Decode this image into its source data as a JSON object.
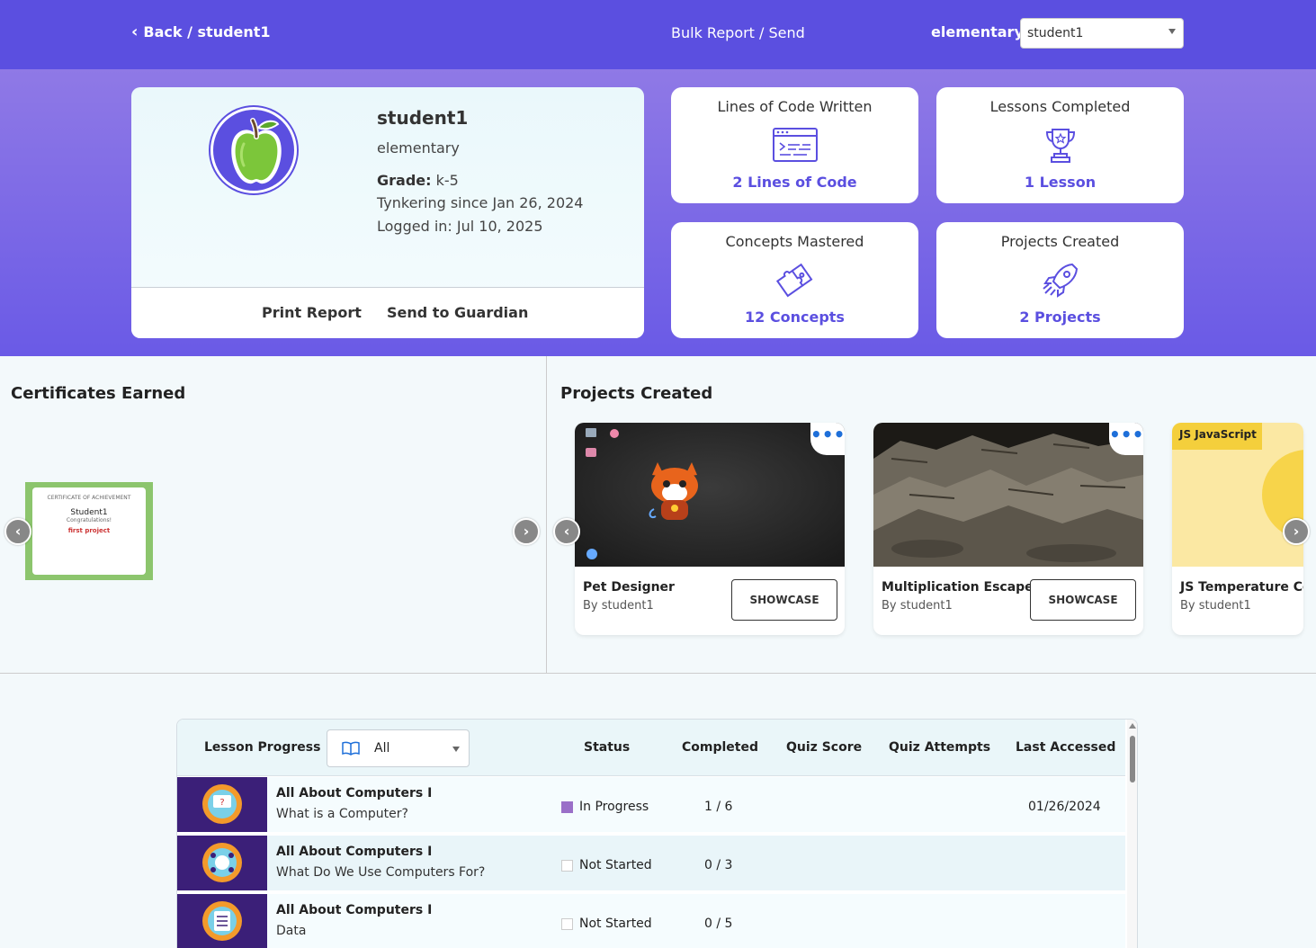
{
  "topbar": {
    "back_label": "Back / student1",
    "bulk_label": "Bulk Report / Send",
    "class_label": "elementary",
    "student_select_value": "student1"
  },
  "profile": {
    "name": "student1",
    "class": "elementary",
    "grade_label": "Grade:",
    "grade_value": "k-5",
    "since": "Tynkering since Jan 26, 2024",
    "logged": "Logged in: Jul 10, 2025",
    "print_label": "Print Report",
    "send_label": "Send to Guardian"
  },
  "stats": [
    {
      "title": "Lines of Code Written",
      "value": "2 Lines of Code",
      "icon": "code-window-icon"
    },
    {
      "title": "Lessons Completed",
      "value": "1 Lesson",
      "icon": "trophy-icon"
    },
    {
      "title": "Concepts Mastered",
      "value": "12 Concepts",
      "icon": "puzzle-icon"
    },
    {
      "title": "Projects Created",
      "value": "2 Projects",
      "icon": "rocket-icon"
    }
  ],
  "certificates": {
    "title": "Certificates Earned",
    "card": {
      "heading": "CERTIFICATE OF ACHIEVEMENT",
      "name": "Student1",
      "congrats": "Congratulations!",
      "achievement": "first project"
    }
  },
  "projects": {
    "title": "Projects Created",
    "items": [
      {
        "name": "Pet Designer",
        "by": "By student1",
        "action": "SHOWCASE"
      },
      {
        "name": "Multiplication Escape",
        "by": "By student1",
        "action": "SHOWCASE"
      },
      {
        "name": "JS Temperature Con",
        "by": "By student1",
        "badge": "JS JavaScript"
      }
    ]
  },
  "lessons": {
    "header": {
      "title": "Lesson Progress",
      "filter_value": "All",
      "status": "Status",
      "completed": "Completed",
      "quiz_score": "Quiz Score",
      "quiz_attempts": "Quiz Attempts",
      "last_accessed": "Last Accessed"
    },
    "rows": [
      {
        "course": "All About Computers I",
        "lesson": "What is a Computer?",
        "status": "In Progress",
        "completed": "1 / 6",
        "last": "01/26/2024"
      },
      {
        "course": "All About Computers I",
        "lesson": "What Do We Use Computers For?",
        "status": "Not Started",
        "completed": "0 / 3",
        "last": ""
      },
      {
        "course": "All About Computers I",
        "lesson": "Data",
        "status": "Not Started",
        "completed": "0 / 5",
        "last": ""
      }
    ]
  },
  "colors": {
    "brand": "#5b4fe0",
    "progress": "#9a6fc8",
    "link_blue": "#1e6fd9"
  }
}
